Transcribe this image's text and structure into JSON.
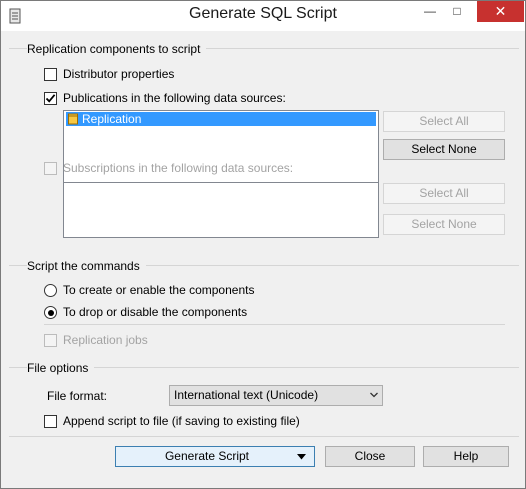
{
  "window": {
    "title": "Generate SQL Script"
  },
  "replication_group": {
    "label": "Replication components to script",
    "distributor": {
      "label": "Distributor properties",
      "checked": false
    },
    "publications": {
      "label": "Publications in the following data sources:",
      "checked": true
    },
    "publications_list": [
      {
        "label": "Replication",
        "icon": "database-icon",
        "selected": true
      }
    ],
    "pub_select_all": "Select All",
    "pub_select_none": "Select None",
    "subscriptions": {
      "label": "Subscriptions in the following data sources:",
      "checked": false,
      "enabled": false
    },
    "sub_select_all": "Select All",
    "sub_select_none": "Select None"
  },
  "commands_group": {
    "label": "Script the commands",
    "create_option": {
      "label": "To create or enable the components",
      "selected": false
    },
    "drop_option": {
      "label": "To drop or disable the components",
      "selected": true
    },
    "replication_jobs": {
      "label": "Replication jobs",
      "checked": false,
      "enabled": false
    }
  },
  "file_group": {
    "label": "File options",
    "format_label": "File format:",
    "format_value": "International text (Unicode)",
    "append": {
      "label": "Append script to file (if saving to existing file)",
      "checked": false
    }
  },
  "buttons": {
    "generate": "Generate Script",
    "close": "Close",
    "help": "Help"
  },
  "colors": {
    "selection": "#3399ff",
    "close_button": "#c7312f",
    "default_button_border": "#3c7fb1"
  }
}
